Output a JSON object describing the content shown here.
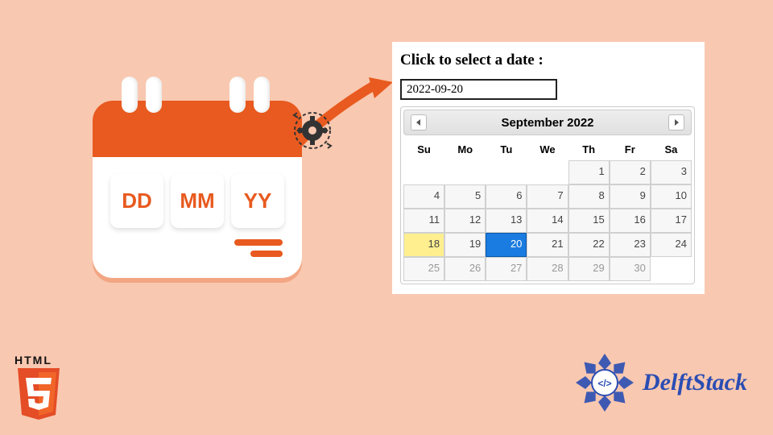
{
  "illustration": {
    "dd": "DD",
    "mm": "MM",
    "yy": "YY"
  },
  "panel": {
    "title": "Click to select a date :",
    "input_value": "2022-09-20"
  },
  "datepicker": {
    "month_title": "September 2022",
    "dow": [
      "Su",
      "Mo",
      "Tu",
      "We",
      "Th",
      "Fr",
      "Sa"
    ],
    "weeks": [
      [
        null,
        null,
        null,
        null,
        1,
        2,
        3
      ],
      [
        4,
        5,
        6,
        7,
        8,
        9,
        10
      ],
      [
        11,
        12,
        13,
        14,
        15,
        16,
        17
      ],
      [
        18,
        19,
        20,
        21,
        22,
        23,
        24
      ],
      [
        25,
        26,
        27,
        28,
        29,
        30,
        null
      ]
    ],
    "today": 18,
    "selected": 20
  },
  "logos": {
    "html5": "HTML",
    "delftstack": "DelftStack"
  }
}
